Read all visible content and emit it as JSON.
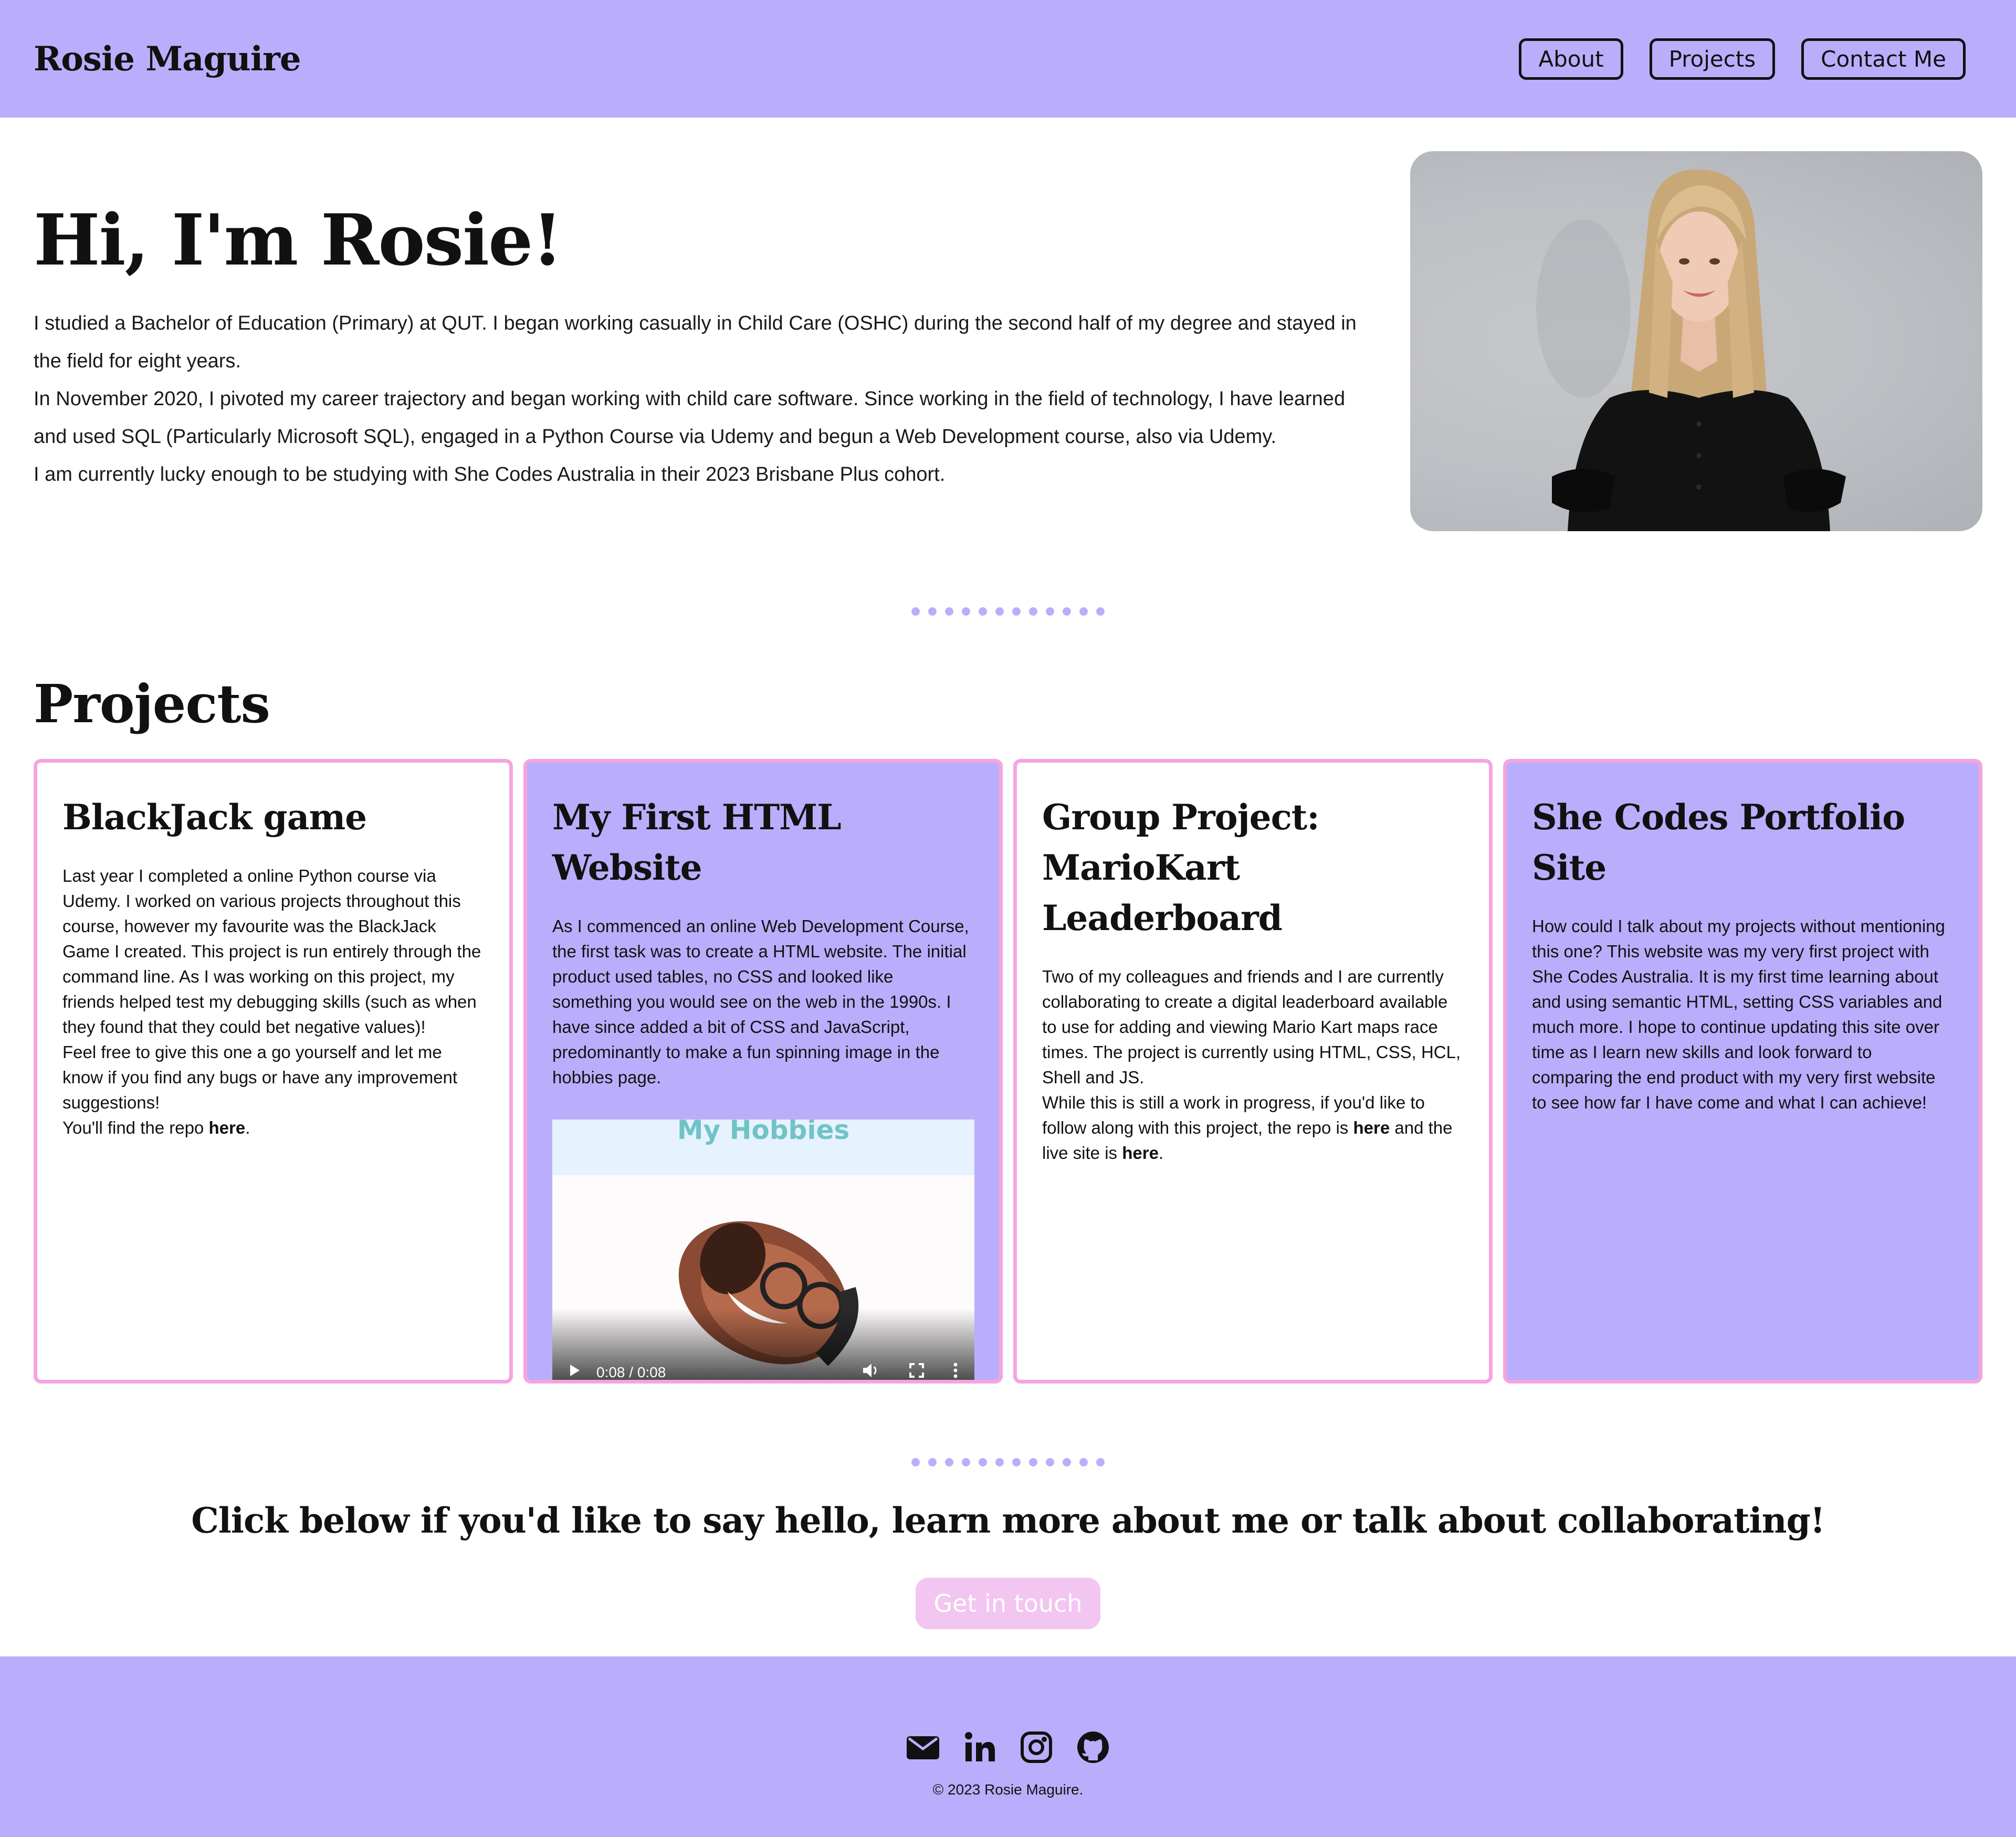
{
  "header": {
    "brand": "Rosie Maguire",
    "nav": [
      {
        "label": "About"
      },
      {
        "label": "Projects"
      },
      {
        "label": "Contact Me"
      }
    ]
  },
  "hero": {
    "title": "Hi, I'm Rosie!",
    "paragraphs": [
      "I studied a Bachelor of Education (Primary) at QUT. I began working casually in Child Care (OSHC) during the second half of my degree and stayed in the field for eight years.",
      "In November 2020, I pivoted my career trajectory and began working with child care software. Since working in the field of technology, I have learned and used SQL (Particularly Microsoft SQL), engaged in a Python Course via Udemy and begun a Web Development course, also via Udemy.",
      "I am currently lucky enough to be studying with She Codes Australia in their 2023 Brisbane Plus cohort."
    ]
  },
  "projects": {
    "title": "Projects",
    "cards": [
      {
        "title": "BlackJack game",
        "paragraphs": [
          "Last year I completed a online Python course via Udemy. I worked on various projects throughout this course, however my favourite was the BlackJack Game I created. This project is run entirely through the command line. As I was working on this project, my friends helped test my debugging skills (such as when they found that they could bet negative values)!",
          "Feel free to give this one a go yourself and let me know if you find any bugs or have any improvement suggestions!"
        ],
        "repo_prefix": "You'll find the repo ",
        "repo_link": "here",
        "repo_suffix": "."
      },
      {
        "title": "My First HTML Website",
        "paragraphs": [
          "As I commenced an online Web Development Course, the first task was to create a HTML website. The initial product used tables, no CSS and looked like something you would see on the web in the 1990s. I have since added a bit of CSS and JavaScript, predominantly to make a fun spinning image in the hobbies page."
        ],
        "video": {
          "banner": "My Hobbies",
          "time": "0:08 / 0:08",
          "progress": 1.0
        }
      },
      {
        "title": "Group Project: MarioKart Leaderboard",
        "paragraphs": [
          "Two of my colleagues and friends and I are currently collaborating to create a digital leaderboard available to use for adding and viewing Mario Kart maps race times. The project is currently using HTML, CSS, HCL, Shell and JS."
        ],
        "repo_prefix": "While this is still a work in progress, if you'd like to follow along with this project, the repo is ",
        "repo_link": "here",
        "repo_middle": " and the live site is ",
        "live_link": "here",
        "repo_suffix": "."
      },
      {
        "title": "She Codes Portfolio Site",
        "paragraphs": [
          "How could I talk about my projects without mentioning this one? This website was my very first project with She Codes Australia. It is my first time learning about and using semantic HTML, setting CSS variables and much more. I hope to continue updating this site over time as I learn new skills and look forward to comparing the end product with my very first website to see how far I have come and what I can achieve!"
        ]
      }
    ]
  },
  "contact": {
    "prompt": "Click below if you'd like to say hello, learn more about me or talk about collaborating!",
    "button": "Get in touch"
  },
  "footer": {
    "icons": [
      "envelope-icon",
      "linkedin-icon",
      "instagram-icon",
      "github-icon"
    ],
    "copyright": "© 2023 Rosie Maguire."
  },
  "colors": {
    "accent": "#baaefc",
    "card_border": "#f5a4df",
    "button": "#f2c6f0"
  }
}
